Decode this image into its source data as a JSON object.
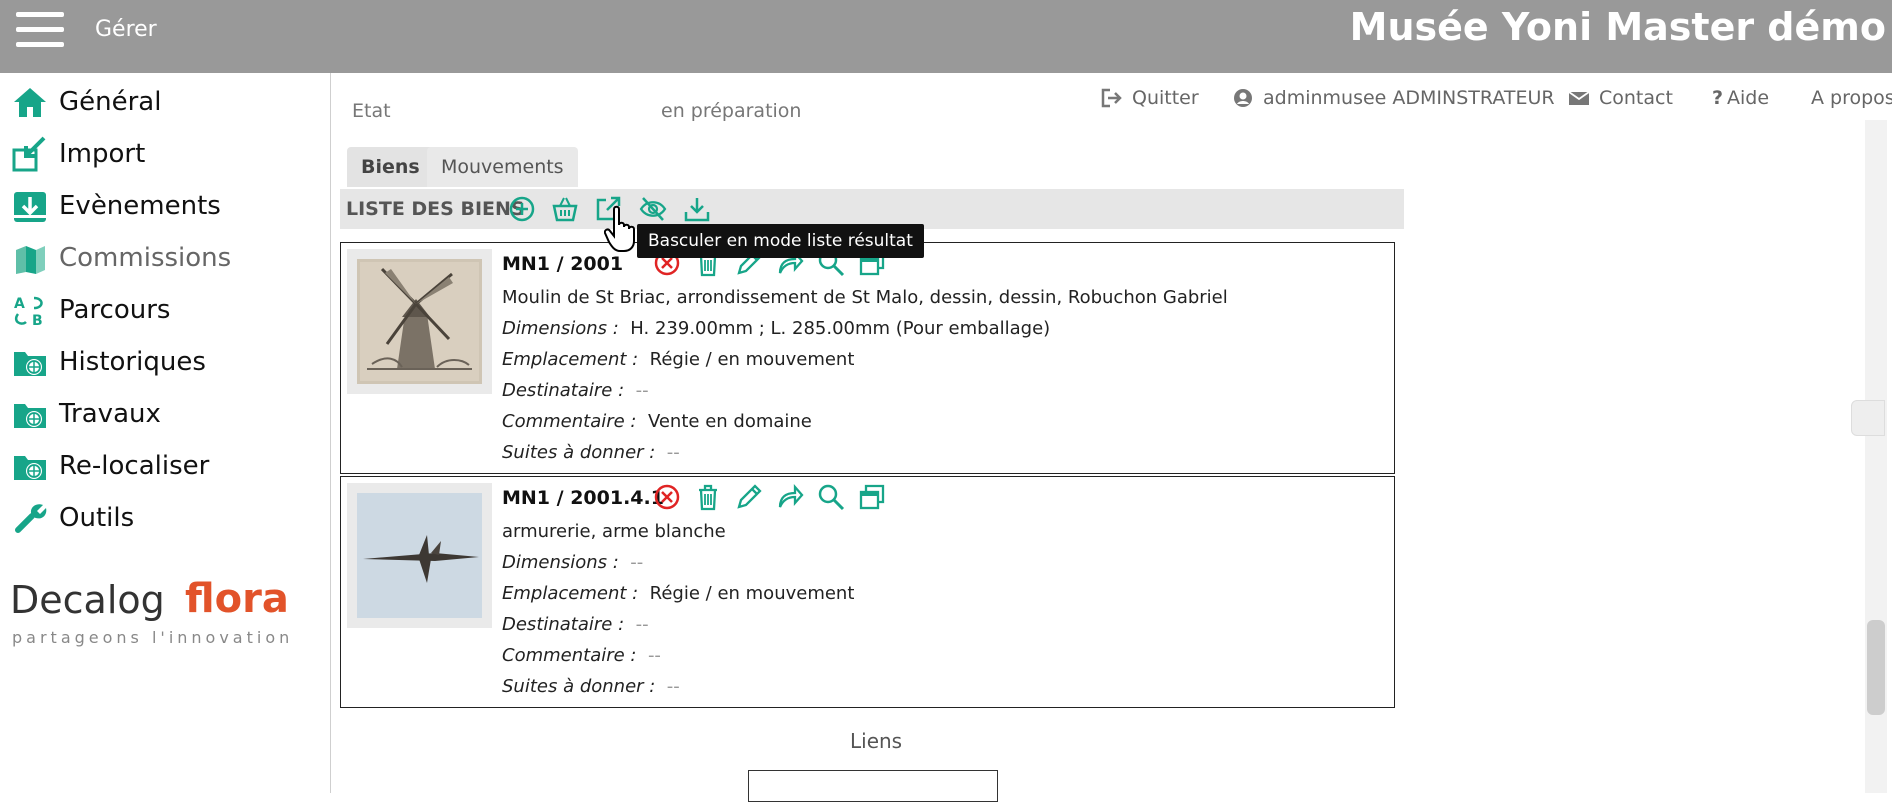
{
  "header": {
    "menu_label": "Gérer",
    "app_title": "Musée Yoni Master démo"
  },
  "sidebar": {
    "items": [
      {
        "label": "Général",
        "icon": "home-icon"
      },
      {
        "label": "Import",
        "icon": "import-icon"
      },
      {
        "label": "Evènements",
        "icon": "download-box-icon"
      },
      {
        "label": "Commissions",
        "icon": "books-icon"
      },
      {
        "label": "Parcours",
        "icon": "route-icon"
      },
      {
        "label": "Historiques",
        "icon": "folder-globe-icon"
      },
      {
        "label": "Travaux",
        "icon": "folder-globe-icon"
      },
      {
        "label": "Re-localiser",
        "icon": "folder-globe-icon"
      },
      {
        "label": "Outils",
        "icon": "wrench-icon"
      }
    ],
    "logo": {
      "part1": "Decalog",
      "part2": "flora",
      "tagline": "partageons l'innovation"
    }
  },
  "toplinks": [
    {
      "label": "Quitter",
      "icon": "sign-out-icon"
    },
    {
      "label": "adminmusee ADMINSTRATEUR",
      "icon": "user-circle-icon"
    },
    {
      "label": "Contact",
      "icon": "envelope-icon"
    },
    {
      "label": "Aide",
      "icon": "question-icon"
    },
    {
      "label": "A propos",
      "icon": ""
    }
  ],
  "cutoff_text": {
    "left": "Etat",
    "right": "en préparation"
  },
  "tabs": [
    {
      "label": "Biens",
      "active": true
    },
    {
      "label": "Mouvements",
      "active": false
    }
  ],
  "list": {
    "title": "LISTE DES BIENS",
    "toolbar_icons": [
      "add-circle-icon",
      "basket-icon",
      "external-link-icon",
      "eye-slash-icon",
      "download-tray-icon"
    ],
    "tooltip": "Basculer en mode liste résultat"
  },
  "items": [
    {
      "ref": "MN1 / 2001.4.4",
      "ref_visible": "MN1 / 2001",
      "description": "Moulin de St Briac, arrondissement de St Malo, dessin, dessin, Robuchon Gabriel",
      "fields": [
        {
          "label": "Dimensions :",
          "value": "H. 239.00mm ; L. 285.00mm (Pour emballage)"
        },
        {
          "label": "Emplacement :",
          "value": "Régie / en mouvement"
        },
        {
          "label": "Destinataire :",
          "value": "--"
        },
        {
          "label": "Commentaire :",
          "value": "Vente en domaine"
        },
        {
          "label": "Suites à donner :",
          "value": "--"
        }
      ]
    },
    {
      "ref": "MN1 / 2001.4.1",
      "ref_visible": "MN1 / 2001.4.1",
      "description": "armurerie, arme blanche",
      "fields": [
        {
          "label": "Dimensions :",
          "value": "--"
        },
        {
          "label": "Emplacement :",
          "value": "Régie / en mouvement"
        },
        {
          "label": "Destinataire :",
          "value": "--"
        },
        {
          "label": "Commentaire :",
          "value": "--"
        },
        {
          "label": "Suites à donner :",
          "value": "--"
        }
      ]
    }
  ],
  "links_section": {
    "title": "Liens"
  },
  "colors": {
    "accent": "#17a589",
    "danger": "#e02424",
    "header_bg": "#999999",
    "brand_orange": "#e2532a"
  }
}
